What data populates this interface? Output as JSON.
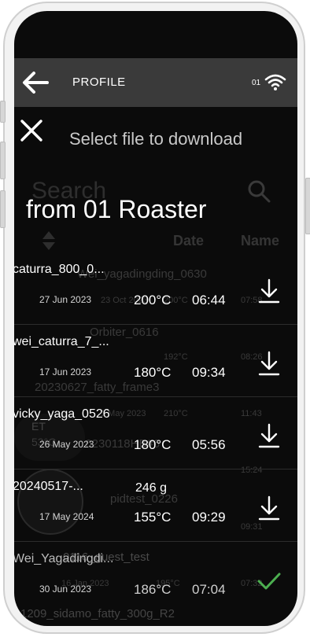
{
  "appbar": {
    "title": "PROFILE",
    "roaster_number": "01"
  },
  "background": {
    "title_text": "Select file to download",
    "search_placeholder": "Search",
    "col_date": "Date",
    "col_name": "Name",
    "items": [
      {
        "name": "Wei_yagadingding_0630",
        "date": "23 Oct 2023",
        "temp": "200°C",
        "time": "07:58"
      },
      {
        "name": "Orbiter_0616",
        "date": "",
        "temp": "192°C",
        "time": "08:26"
      },
      {
        "name": "20230627_fatty_frame3",
        "date": "1 May 2023",
        "temp": "210°C",
        "time": "11:43"
      },
      {
        "name": "20230118HB#6",
        "date": "",
        "temp": "",
        "time": "15:24"
      },
      {
        "name": "pidtest_0226",
        "date": "",
        "temp": "",
        "time": "09:31"
      },
      {
        "name": "0116_guest_test",
        "date": "16 Jan 2023",
        "temp": "195°C",
        "time": "07:32"
      },
      {
        "name": "1209_sidamo_fatty_300g_R2",
        "date": "",
        "temp": "",
        "time": ""
      }
    ],
    "et_label": "ET",
    "et_value": "53°C"
  },
  "modal": {
    "title": "Select file to download",
    "heading": "from 01 Roaster",
    "files": [
      {
        "name": "caturra_800_0...",
        "weight": "",
        "date": "27 Jun 2023",
        "temp": "200°C",
        "time": "06:44",
        "status": "download"
      },
      {
        "name": "wei_caturra_7_...",
        "weight": "",
        "date": "17 Jun 2023",
        "temp": "180°C",
        "time": "09:34",
        "status": "download"
      },
      {
        "name": "vicky_yaga_0526",
        "weight": "",
        "date": "26 May 2023",
        "temp": "180°C",
        "time": "05:56",
        "status": "download"
      },
      {
        "name": "20240517-...",
        "weight": "246 g",
        "date": "17 May 2024",
        "temp": "155°C",
        "time": "09:29",
        "status": "download"
      },
      {
        "name": "Wei_Yagadingdi...",
        "weight": "",
        "date": "30 Jun 2023",
        "temp": "186°C",
        "time": "07:04",
        "status": "downloaded"
      }
    ]
  },
  "colors": {
    "background": "#0b0b0b",
    "appbar": "#3a3a3a",
    "text": "#ffffff",
    "check": "#4caf50"
  }
}
